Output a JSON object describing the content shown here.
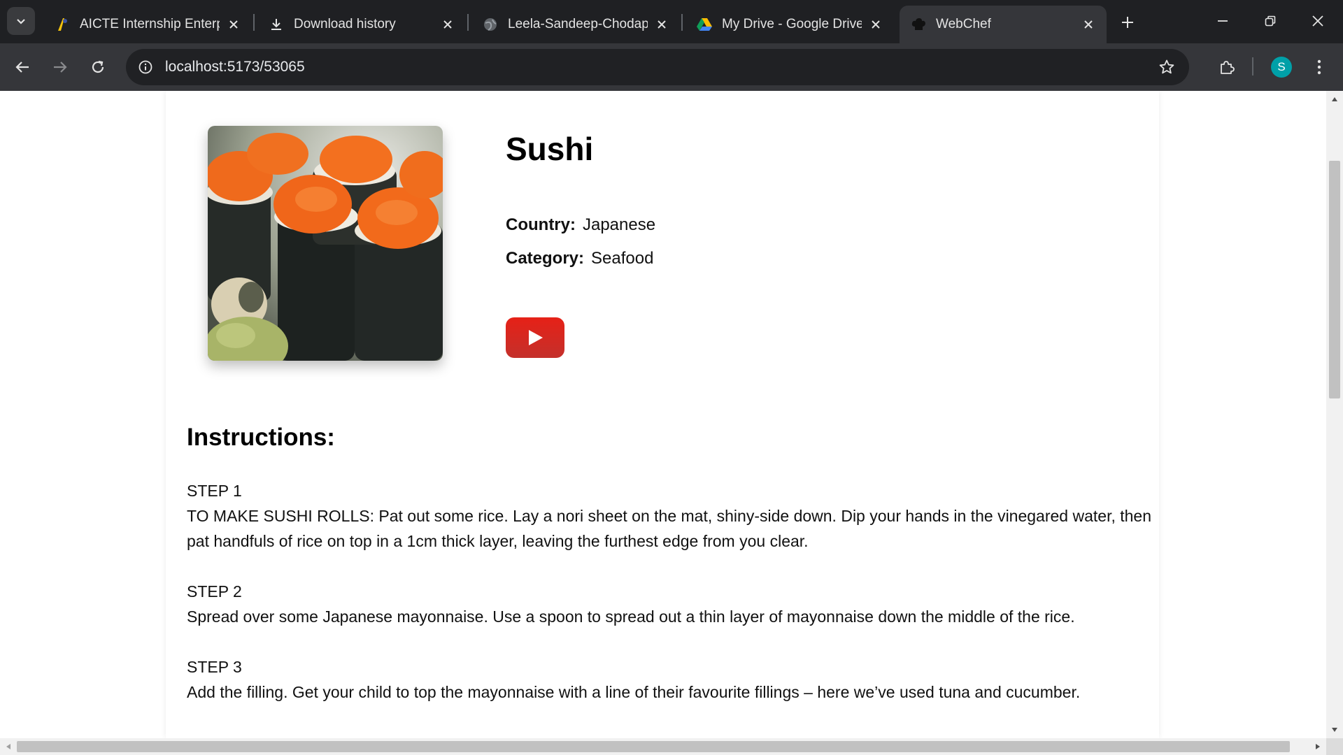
{
  "browser": {
    "tabs": [
      {
        "title": "AICTE Internship Enterpri",
        "icon": "aicte-favicon"
      },
      {
        "title": "Download history",
        "icon": "download-icon"
      },
      {
        "title": "Leela-Sandeep-Chodapu",
        "icon": "globe-icon"
      },
      {
        "title": "My Drive - Google Drive",
        "icon": "google-drive-icon"
      },
      {
        "title": "WebChef",
        "icon": "chef-hat-icon",
        "active": true
      }
    ],
    "url": "localhost:5173/53065",
    "profile_initial": "S",
    "accent_color": "#00a0a8"
  },
  "recipe": {
    "title": "Sushi",
    "country_label": "Country:",
    "country": "Japanese",
    "category_label": "Category:",
    "category": "Seafood",
    "youtube_color": "#e62117"
  },
  "instructions": {
    "heading": "Instructions:",
    "steps": [
      {
        "label": "STEP 1",
        "text": "TO MAKE SUSHI ROLLS: Pat out some rice. Lay a nori sheet on the mat, shiny-side down. Dip your hands in the vinegared water, then pat handfuls of rice on top in a 1cm thick layer, leaving the furthest edge from you clear."
      },
      {
        "label": "STEP 2",
        "text": "Spread over some Japanese mayonnaise. Use a spoon to spread out a thin layer of mayonnaise down the middle of the rice."
      },
      {
        "label": "STEP 3",
        "text": "Add the filling. Get your child to top the mayonnaise with a line of their favourite fillings – here we’ve used tuna and cucumber."
      }
    ]
  }
}
